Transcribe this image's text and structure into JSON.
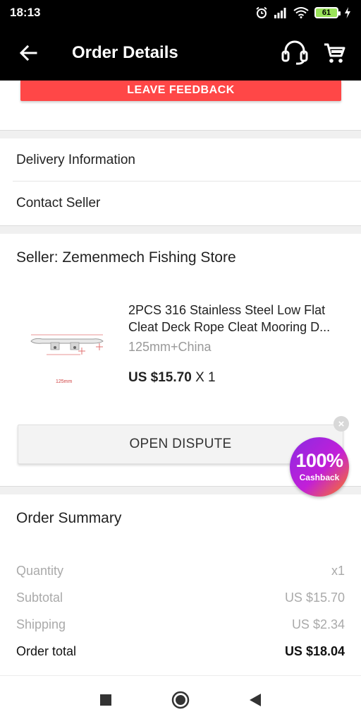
{
  "status_bar": {
    "time": "18:13",
    "battery": "61"
  },
  "app_bar": {
    "title": "Order Details",
    "back_icon": "arrow-left-icon",
    "support_icon": "headset-icon",
    "cart_icon": "cart-icon"
  },
  "feedback": {
    "label": "LEAVE FEEDBACK"
  },
  "menu": {
    "delivery": "Delivery Information",
    "contact": "Contact Seller"
  },
  "seller": {
    "name": "Seller: Zemenmech Fishing Store",
    "product": {
      "title_line1": "2PCS 316 Stainless Steel Low Flat",
      "title_line2": "Cleat Deck Rope Cleat Mooring D...",
      "variant": "125mm+China",
      "price": "US $15.70",
      "qty": "X 1",
      "thumb_caption": "125mm"
    },
    "dispute_label": "OPEN DISPUTE"
  },
  "cashback": {
    "percent": "100%",
    "label": "Cashback"
  },
  "summary": {
    "title": "Order Summary",
    "rows": [
      {
        "label": "Quantity",
        "value": "x1"
      },
      {
        "label": "Subtotal",
        "value": "US $15.70"
      },
      {
        "label": "Shipping",
        "value": "US $2.34"
      },
      {
        "label": "Order total",
        "value": "US $18.04"
      }
    ]
  },
  "colors": {
    "accent_red": "#ff4747",
    "bar_black": "#000000",
    "muted_text": "#aaaaaa"
  }
}
